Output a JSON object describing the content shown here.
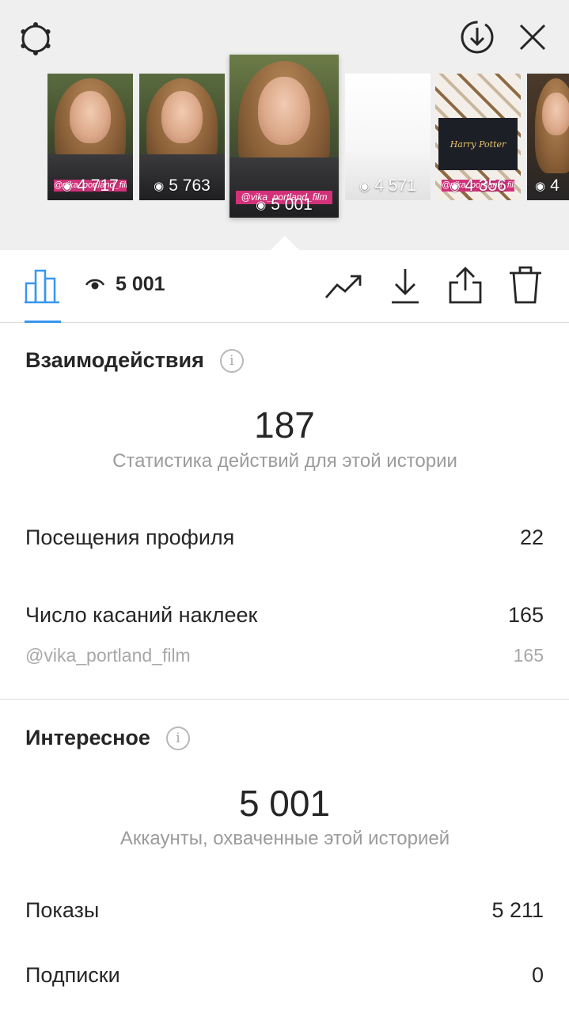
{
  "header": {
    "settings_icon": "gear-icon",
    "download_icon": "download-circle-icon",
    "close_icon": "close-icon"
  },
  "thumbnails": [
    {
      "views": "4 717",
      "tag": "@vika_portland_film"
    },
    {
      "views": "5 763",
      "tag": ""
    },
    {
      "views": "5 001",
      "tag": "@vika_portland_film"
    },
    {
      "views": "4 571",
      "tag": ""
    },
    {
      "views": "4 356",
      "tag": "@vika_portland_film",
      "image_text": "Harry Potter"
    },
    {
      "views": "4",
      "tag": ""
    }
  ],
  "toolbar": {
    "views_count": "5 001",
    "icons": [
      "bar-chart-icon",
      "eye-icon",
      "trend-icon",
      "download-icon",
      "share-icon",
      "trash-icon"
    ]
  },
  "interactions": {
    "title": "Взаимодействия",
    "total": "187",
    "caption": "Статистика действий для этой истории",
    "rows": [
      {
        "label": "Посещения профиля",
        "value": "22"
      },
      {
        "label": "Число касаний наклеек",
        "value": "165"
      },
      {
        "label": "@vika_portland_film",
        "value": "165"
      }
    ]
  },
  "discovery": {
    "title": "Интересное",
    "total": "5 001",
    "caption": "Аккаунты, охваченные этой историей",
    "rows": [
      {
        "label": "Показы",
        "value": "5 211"
      },
      {
        "label": "Подписки",
        "value": "0"
      }
    ]
  },
  "colors": {
    "accent": "#3897f0",
    "tag": "#d2317a",
    "text": "#262626",
    "muted": "#9b9b9b"
  }
}
